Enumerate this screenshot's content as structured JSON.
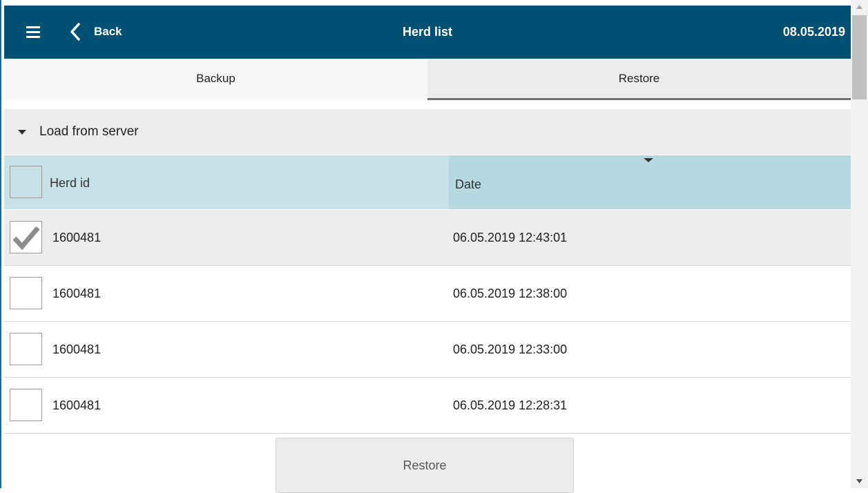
{
  "header": {
    "back_label": "Back",
    "title": "Herd list",
    "date": "08.05.2019"
  },
  "tabs": [
    {
      "label": "Backup",
      "active": false
    },
    {
      "label": "Restore",
      "active": true
    }
  ],
  "section": {
    "label": "Load from server"
  },
  "table": {
    "columns": [
      "Herd id",
      "Date"
    ],
    "sort_column": "Date",
    "rows": [
      {
        "herd_id": "1600481",
        "date": "06.05.2019 12:43:01",
        "selected": true
      },
      {
        "herd_id": "1600481",
        "date": "06.05.2019 12:38:00",
        "selected": false
      },
      {
        "herd_id": "1600481",
        "date": "06.05.2019 12:33:00",
        "selected": false
      },
      {
        "herd_id": "1600481",
        "date": "06.05.2019 12:28:31",
        "selected": false
      }
    ]
  },
  "actions": {
    "restore_label": "Restore"
  },
  "colors": {
    "header_bg": "#005073",
    "herd_column_header_bg": "#c7e1e8",
    "date_column_header_bg": "#b5d8e1",
    "selected_row_bg": "#ececec"
  },
  "icons": {
    "menu": "hamburger-menu-icon",
    "back": "chevron-left-icon",
    "section_toggle": "caret-down-icon",
    "sort": "sort-descending-icon",
    "checked": "checkmark-icon"
  }
}
